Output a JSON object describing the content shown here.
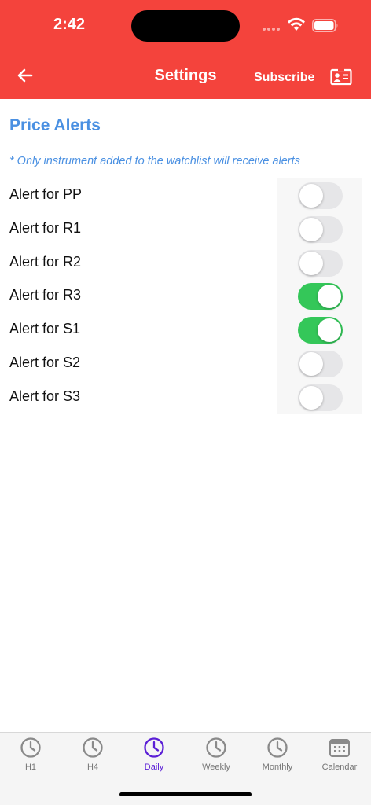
{
  "status_bar": {
    "time": "2:42"
  },
  "app_bar": {
    "title": "Settings",
    "subscribe_label": "Subscribe",
    "back_icon": "arrow-left-icon",
    "contact_icon": "contact-card-icon",
    "background_color": "#f4433c"
  },
  "section": {
    "title": "Price Alerts",
    "note": "* Only instrument added to the watchlist will receive alerts"
  },
  "alerts": [
    {
      "label": "Alert for PP",
      "enabled": false
    },
    {
      "label": "Alert for R1",
      "enabled": false
    },
    {
      "label": "Alert for R2",
      "enabled": false
    },
    {
      "label": "Alert for R3",
      "enabled": true
    },
    {
      "label": "Alert for S1",
      "enabled": true
    },
    {
      "label": "Alert for S2",
      "enabled": false
    },
    {
      "label": "Alert for S3",
      "enabled": false
    }
  ],
  "tabs": [
    {
      "label": "H1",
      "icon": "clock-icon",
      "active": false
    },
    {
      "label": "H4",
      "icon": "clock-icon",
      "active": false
    },
    {
      "label": "Daily",
      "icon": "clock-icon",
      "active": true
    },
    {
      "label": "Weekly",
      "icon": "clock-icon",
      "active": false
    },
    {
      "label": "Monthly",
      "icon": "clock-icon",
      "active": false
    },
    {
      "label": "Calendar",
      "icon": "calendar-icon",
      "active": false
    }
  ],
  "colors": {
    "accent_blue": "#4a90e2",
    "switch_on": "#34c759",
    "active_tab": "#5b1fd6"
  }
}
